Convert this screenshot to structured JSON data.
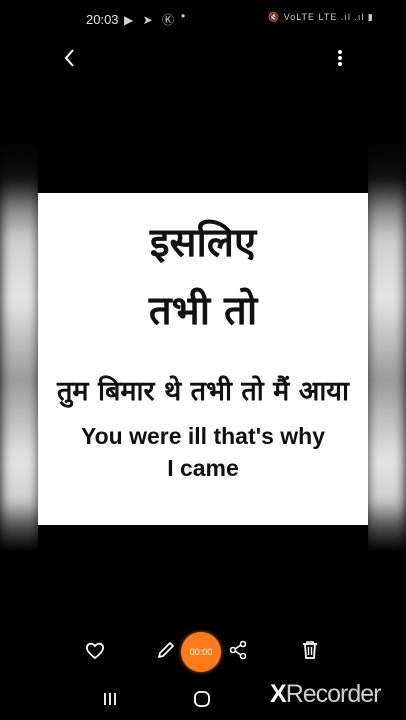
{
  "status_bar": {
    "time": "20:03",
    "left_icons": "▶ ➤ Ⓚ",
    "dot": "•",
    "right_icons": "🔇 VoLTE LTE .ıl .ıl ▮"
  },
  "image_text": {
    "hindi_line1": "इसलिए",
    "hindi_line2": "तभी तो",
    "hindi_sentence": "तुम बिमार थे तभी तो मैं आया",
    "english_line1": "You were ill that's why",
    "english_line2": "I came"
  },
  "toolbar": {
    "timer": "00:00"
  },
  "watermark": {
    "x": "X",
    "rest": "Recorder"
  },
  "colors": {
    "accent": "#ff7a1a",
    "background": "#000000"
  }
}
